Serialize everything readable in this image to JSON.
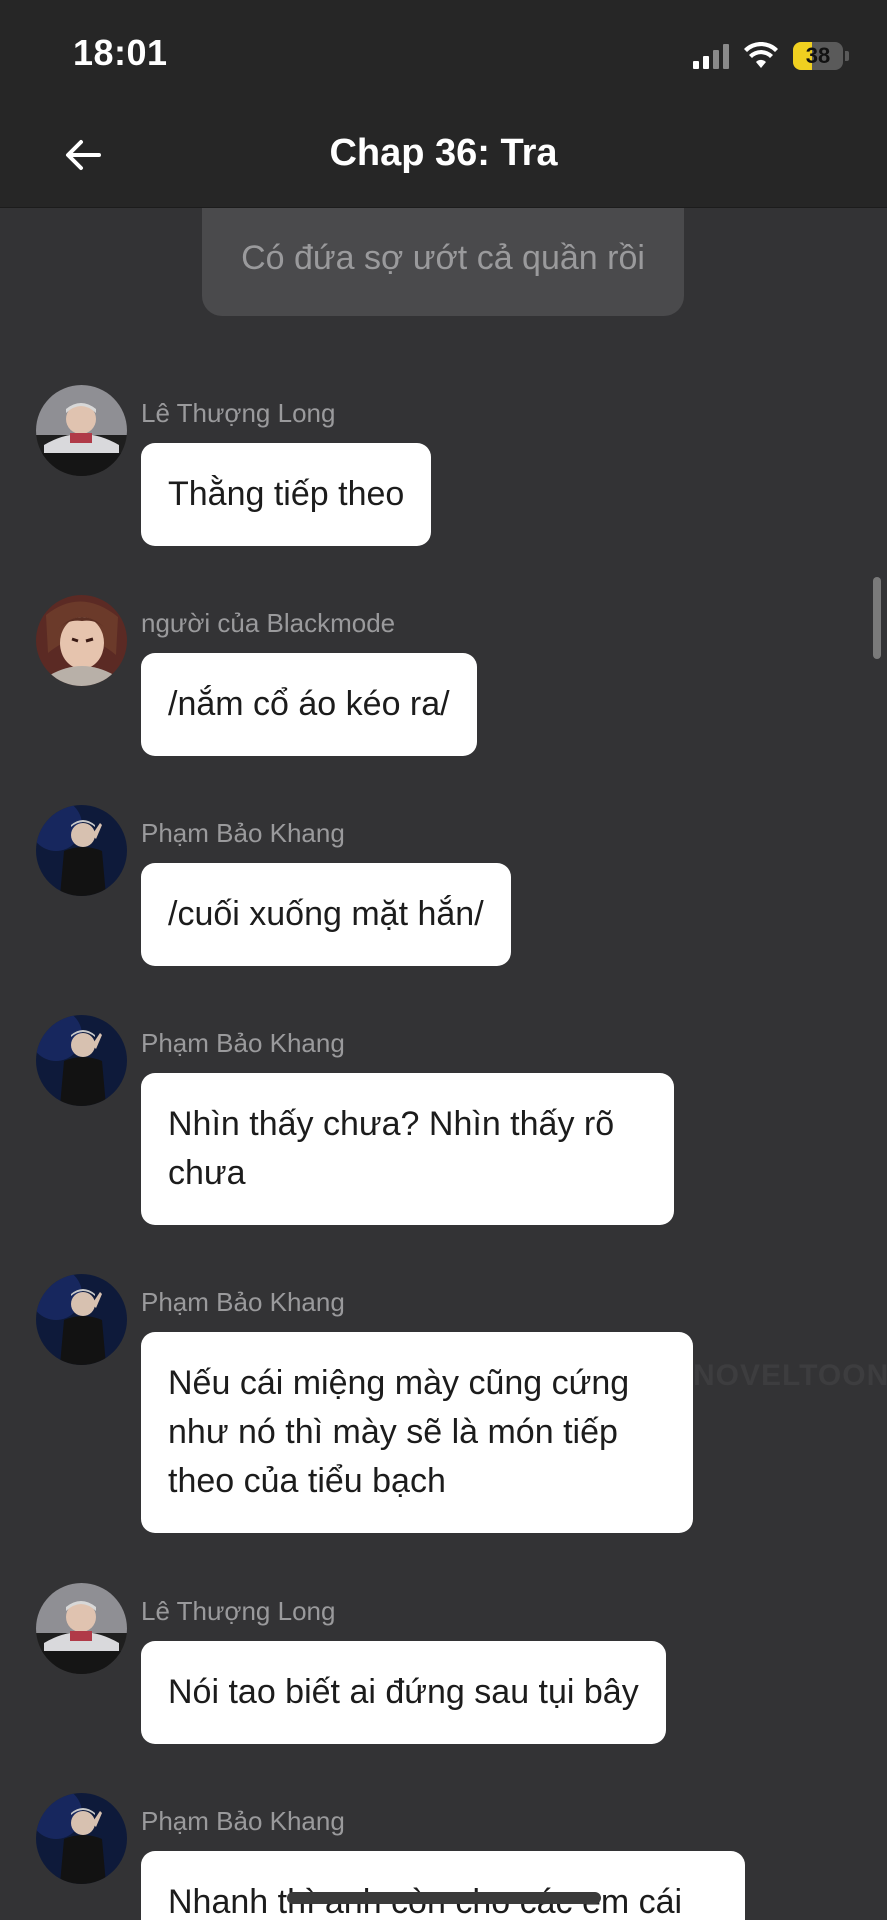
{
  "status_bar": {
    "time": "18:01",
    "battery": "38",
    "battery_level": 0.38,
    "signal_bars": 2
  },
  "header": {
    "title": "Chap 36: Tra",
    "back_icon": "arrow-left-icon"
  },
  "narration": {
    "text": "Có đứa sợ ướt cả quần rồi"
  },
  "messages": [
    {
      "sender": "Lê Thượng Long",
      "text": "Thằng tiếp theo"
    },
    {
      "sender": "người của Blackmode",
      "text": "/nắm cổ áo kéo ra/"
    },
    {
      "sender": "Phạm Bảo Khang",
      "text": "/cuối xuống mặt hắn/"
    },
    {
      "sender": "Phạm Bảo Khang",
      "text": "Nhìn thấy chưa? Nhìn thấy rõ chưa"
    },
    {
      "sender": "Phạm Bảo Khang",
      "text": "Nếu cái miệng mày cũng cứng như nó thì mày sẽ là món tiếp theo của tiểu bạch"
    },
    {
      "sender": "Lê Thượng Long",
      "text": "Nói tao biết ai đứng sau tụi bây"
    },
    {
      "sender": "Phạm Bảo Khang",
      "text": "Nhanh thì anh còn cho các em cái"
    }
  ],
  "watermark": "NOVELTOON",
  "colors": {
    "background": "#333335",
    "header": "#262626",
    "bubble": "#ffffff",
    "sender_text": "#9a9a9c",
    "battery_fill": "#f0d020"
  }
}
